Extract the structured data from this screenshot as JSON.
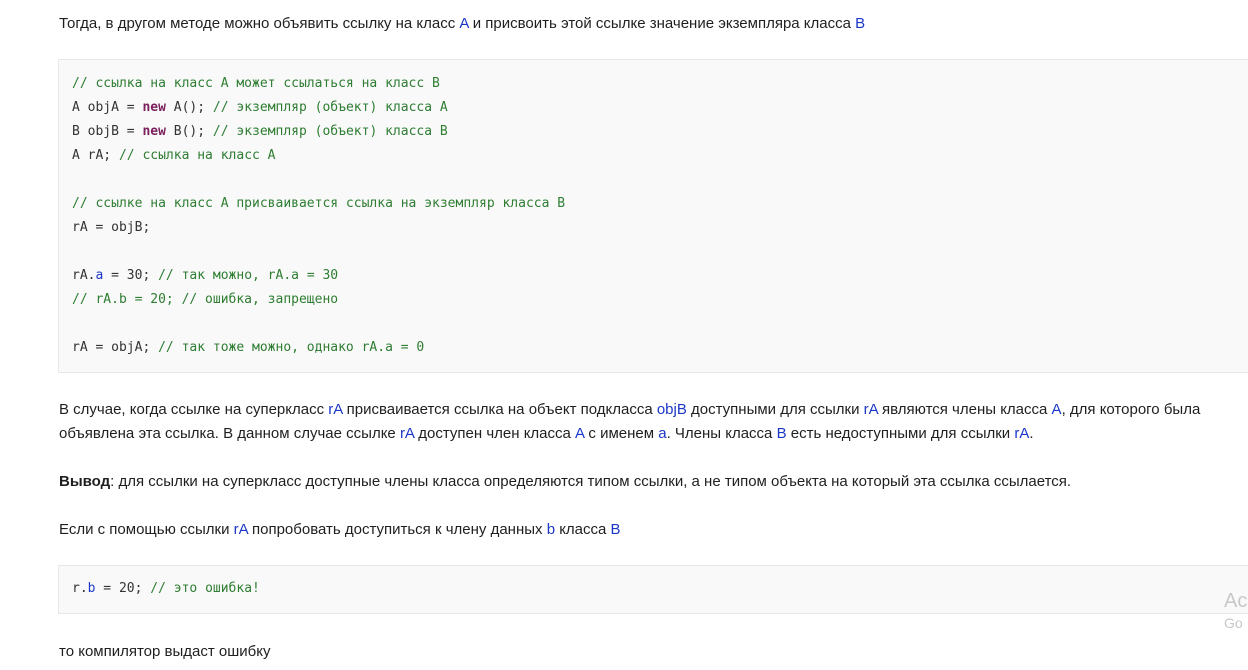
{
  "intro": {
    "t1": "Тогда, в другом методе можно объявить ссылку на класс ",
    "ref1": "A",
    "t2": " и присвоить этой ссылке значение экземпляра класса ",
    "ref2": "B"
  },
  "code1": {
    "l1_comment": "// ссылка на класс A может ссылаться на класс B",
    "l2_a": "A objA = ",
    "l2_kw": "new",
    "l2_b": " A(); ",
    "l2_comment": "// экземпляр (объект) класса A",
    "l3_a": "B objB = ",
    "l3_kw": "new",
    "l3_b": " B(); ",
    "l3_comment": "// экземпляр (объект) класса B",
    "l4_a": "A rA; ",
    "l4_comment": "// ссылка на класс A",
    "l5_comment": "// ссылке на класс A присваивается ссылка на экземпляр класса B",
    "l6": "rA = objB;",
    "l7_a": "rA.",
    "l7_prop": "a",
    "l7_b": " = 30; ",
    "l7_comment": "// так можно, rA.a = 30",
    "l8_comment": "// rA.b = 20; // ошибка, запрещено",
    "l9_a": "rA = objA; ",
    "l9_comment": "// так тоже можно, однако rA.a = 0"
  },
  "explain": {
    "l1_t1": "В случае, когда ссылке на суперкласс ",
    "l1_r1": "rA",
    "l1_t2": " присваивается ссылка на объект подкласса ",
    "l1_r2": "objB",
    "l1_t3": " доступными для ссылки ",
    "l1_r3": "rA",
    "l1_t4": " являются члены класса ",
    "l1_r4": "A",
    "l1_t5": ", для которого была",
    "l2_t1": "объявлена эта ссылка. В данном случае ссылке ",
    "l2_r1": "rA",
    "l2_t2": " доступен член класса ",
    "l2_r2": "A",
    "l2_t3": " с именем ",
    "l2_r3": "a",
    "l2_t4": ". Члены класса ",
    "l2_r4": "B",
    "l2_t5": " есть недоступными для ссылки ",
    "l2_r5": "rA",
    "l2_t6": "."
  },
  "conclusion": {
    "bold": "Вывод",
    "text": ": для ссылки на суперкласс доступные члены класса определяются типом ссылки, а не типом объекта на который эта ссылка ссылается."
  },
  "attempt": {
    "t1": "Если с помощью ссылки ",
    "r1": "rA",
    "t2": " попробовать доступиться к члену данных ",
    "r2": "b",
    "t3": " класса ",
    "r3": "B"
  },
  "code2": {
    "a": "r.",
    "prop": "b",
    "b": " = 20; ",
    "comment": "// это ошибка!"
  },
  "final": {
    "text": "то компилятор выдаст ошибку"
  },
  "watermark": {
    "line1": "Ac",
    "line2": "Go"
  }
}
